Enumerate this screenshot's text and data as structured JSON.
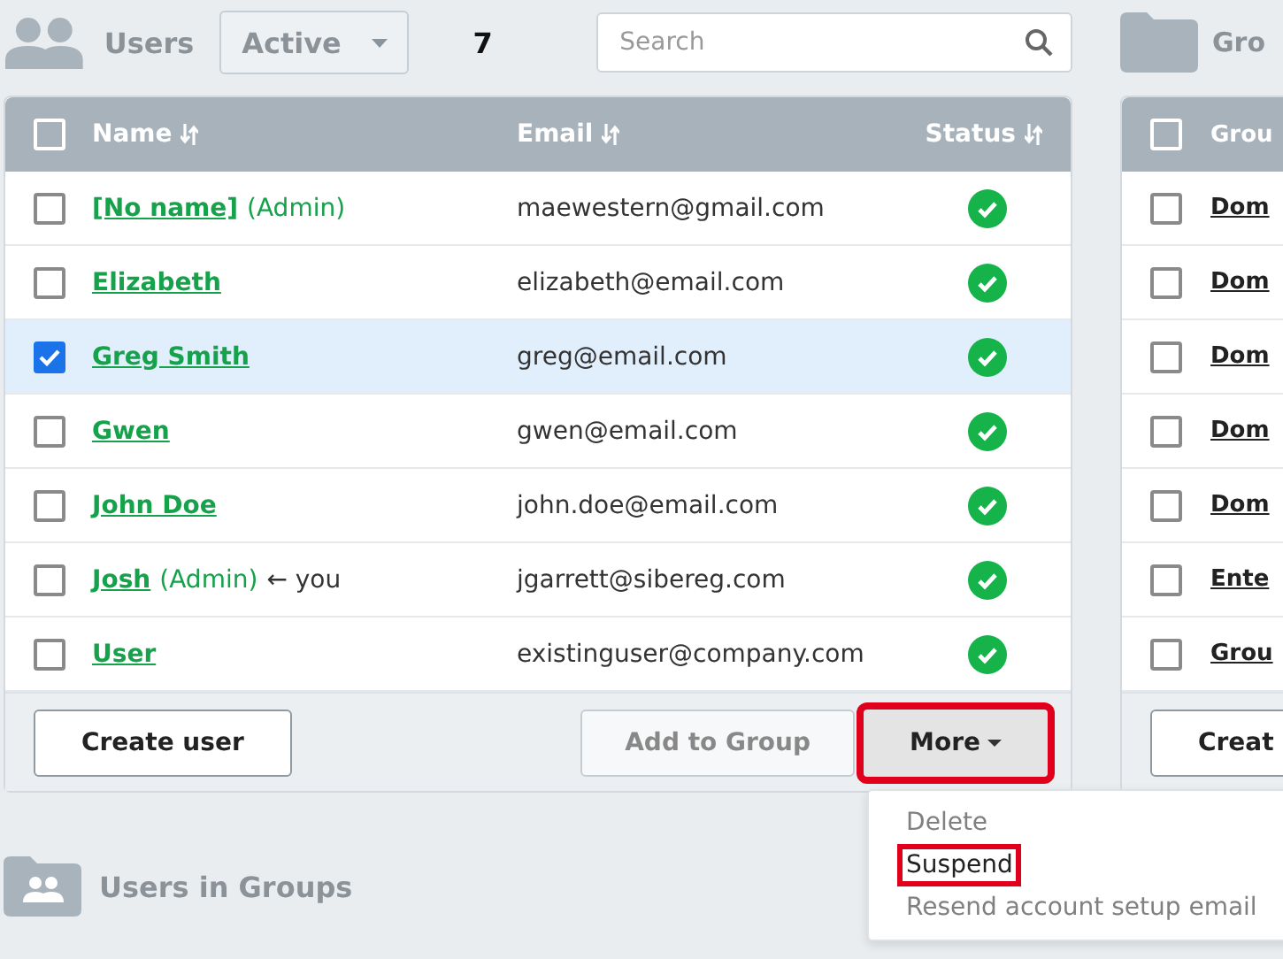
{
  "users_panel": {
    "title": "Users",
    "filter": {
      "value": "Active"
    },
    "count": "7",
    "search": {
      "placeholder": "Search"
    },
    "columns": [
      {
        "label": "Name"
      },
      {
        "label": "Email"
      },
      {
        "label": "Status"
      }
    ],
    "select_all": {
      "checked": false
    },
    "rows": [
      {
        "name": "[No name]",
        "role": "(Admin)",
        "email": "maewestern@gmail.com",
        "active": true,
        "selected": false
      },
      {
        "name": "Elizabeth",
        "email": "elizabeth@email.com",
        "active": true,
        "selected": false
      },
      {
        "name": "Greg Smith",
        "email": "greg@email.com",
        "active": true,
        "selected": true
      },
      {
        "name": "Gwen",
        "email": "gwen@email.com",
        "active": true,
        "selected": false
      },
      {
        "name": "John Doe",
        "email": "john.doe@email.com",
        "active": true,
        "selected": false
      },
      {
        "name": "Josh",
        "role": "(Admin)",
        "note": "← you",
        "email": "jgarrett@sibereg.com",
        "active": true,
        "selected": false
      },
      {
        "name": "User",
        "email": "existinguser@company.com",
        "active": true,
        "selected": false
      }
    ],
    "buttons": [
      {
        "label": "Create user",
        "disabled": false,
        "highlighted": false
      },
      {
        "label": "Add to Group",
        "disabled": true,
        "highlighted": false
      },
      {
        "label": "More",
        "disabled": false,
        "highlighted": true,
        "expanded": true
      }
    ],
    "menu": [
      {
        "label": "Delete",
        "disabled": true,
        "highlighted": false
      },
      {
        "label": "Suspend",
        "disabled": false,
        "highlighted": true
      },
      {
        "label": "Resend account setup email",
        "disabled": true,
        "highlighted": false
      }
    ]
  },
  "groups_panel": {
    "title": "Gro",
    "column": "Grou",
    "select_all": {
      "checked": false
    },
    "rows": [
      {
        "name": "Dom",
        "selected": false
      },
      {
        "name": "Dom",
        "selected": false
      },
      {
        "name": "Dom",
        "selected": false
      },
      {
        "name": "Dom",
        "selected": false
      },
      {
        "name": "Dom",
        "selected": false
      },
      {
        "name": "Ente",
        "selected": false
      },
      {
        "name": "Grou",
        "selected": false
      }
    ],
    "button": "Creat"
  },
  "users_in_groups": {
    "title": "Users in Groups"
  }
}
